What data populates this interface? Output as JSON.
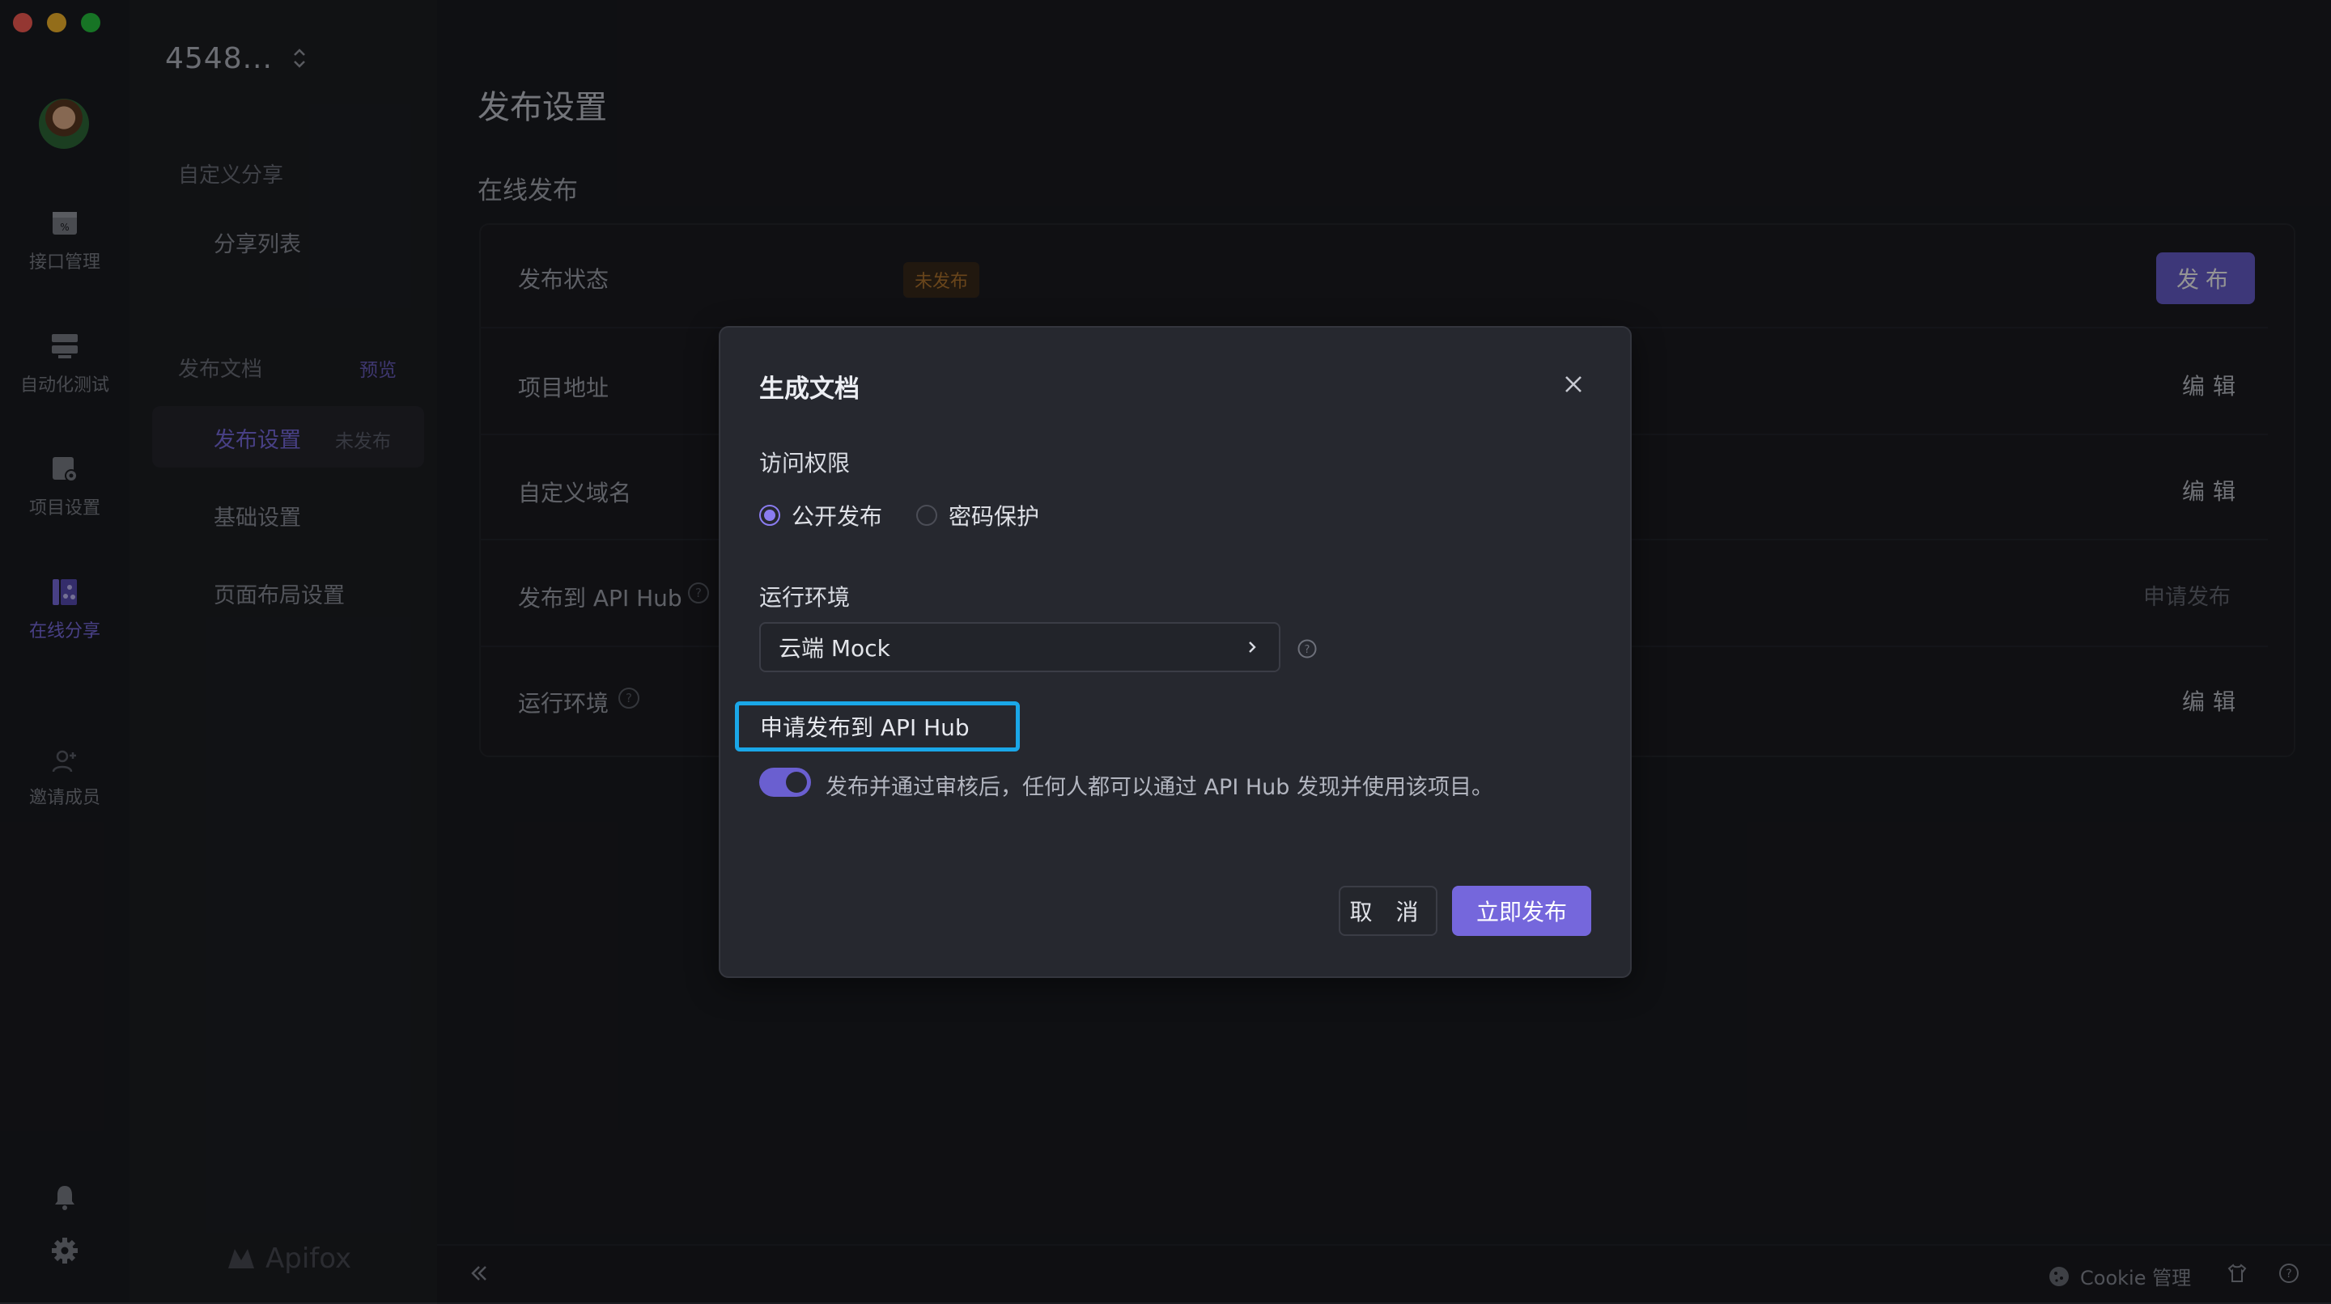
{
  "project": {
    "title": "4548..."
  },
  "rail": {
    "items": [
      {
        "label": "接口管理",
        "icon": "api-icon"
      },
      {
        "label": "自动化测试",
        "icon": "automation-icon"
      },
      {
        "label": "项目设置",
        "icon": "project-settings-icon"
      },
      {
        "label": "在线分享",
        "icon": "share-icon",
        "active": true
      },
      {
        "label": "邀请成员",
        "icon": "invite-member-icon"
      }
    ]
  },
  "subnav": {
    "group_custom_share": "自定义分享",
    "share_list": "分享列表",
    "group_publish_docs": "发布文档",
    "preview_link": "预览",
    "publish_settings": "发布设置",
    "unpublished_tag": "未发布",
    "basic_settings": "基础设置",
    "layout_settings": "页面布局设置",
    "brand": "Apifox"
  },
  "main": {
    "page_title": "发布设置",
    "section_title": "在线发布",
    "rows": {
      "status_label": "发布状态",
      "status_value": "未发布",
      "publish_button": "发布",
      "project_url_label": "项目地址",
      "custom_domain_label": "自定义域名",
      "api_hub_label": "发布到 API Hub",
      "runtime_env_label": "运行环境",
      "edit": "编辑",
      "apply_publish": "申请发布"
    }
  },
  "statusbar": {
    "cookie": "Cookie 管理"
  },
  "modal": {
    "title": "生成文档",
    "access_label": "访问权限",
    "radio_public": "公开发布",
    "radio_password": "密码保护",
    "env_label": "运行环境",
    "env_value": "云端 Mock",
    "hub_heading": "申请发布到 API Hub",
    "hub_desc": "发布并通过审核后，任何人都可以通过 API Hub 发现并使用该项目。",
    "cancel": "取 消",
    "publish_now": "立即发布"
  },
  "colors": {
    "accent": "#7567dc",
    "highlight": "#1aa7e8",
    "warning": "#b5782f"
  }
}
